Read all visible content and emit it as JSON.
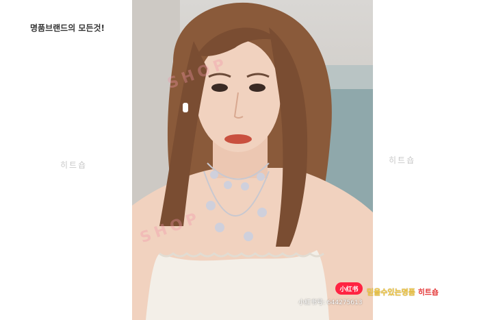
{
  "header": {
    "title": "명품브랜드의 모든것!"
  },
  "watermarks": {
    "left": "히트숍",
    "right": "히트숍",
    "photo_overlay_top": "SHOP",
    "photo_overlay_mid": "SHOP"
  },
  "app_badge": {
    "label": "小红书",
    "color": "#ff2442"
  },
  "app_id": {
    "text": "小红书号: 644275613"
  },
  "promo": {
    "part1": "믿을수있는명품",
    "part2": "히트숍"
  },
  "colors": {
    "background": "#ffffff",
    "hair": "#8a5a3a",
    "skin": "#f1d2bf",
    "top": "#f3efe8",
    "lips": "#c9503f"
  }
}
